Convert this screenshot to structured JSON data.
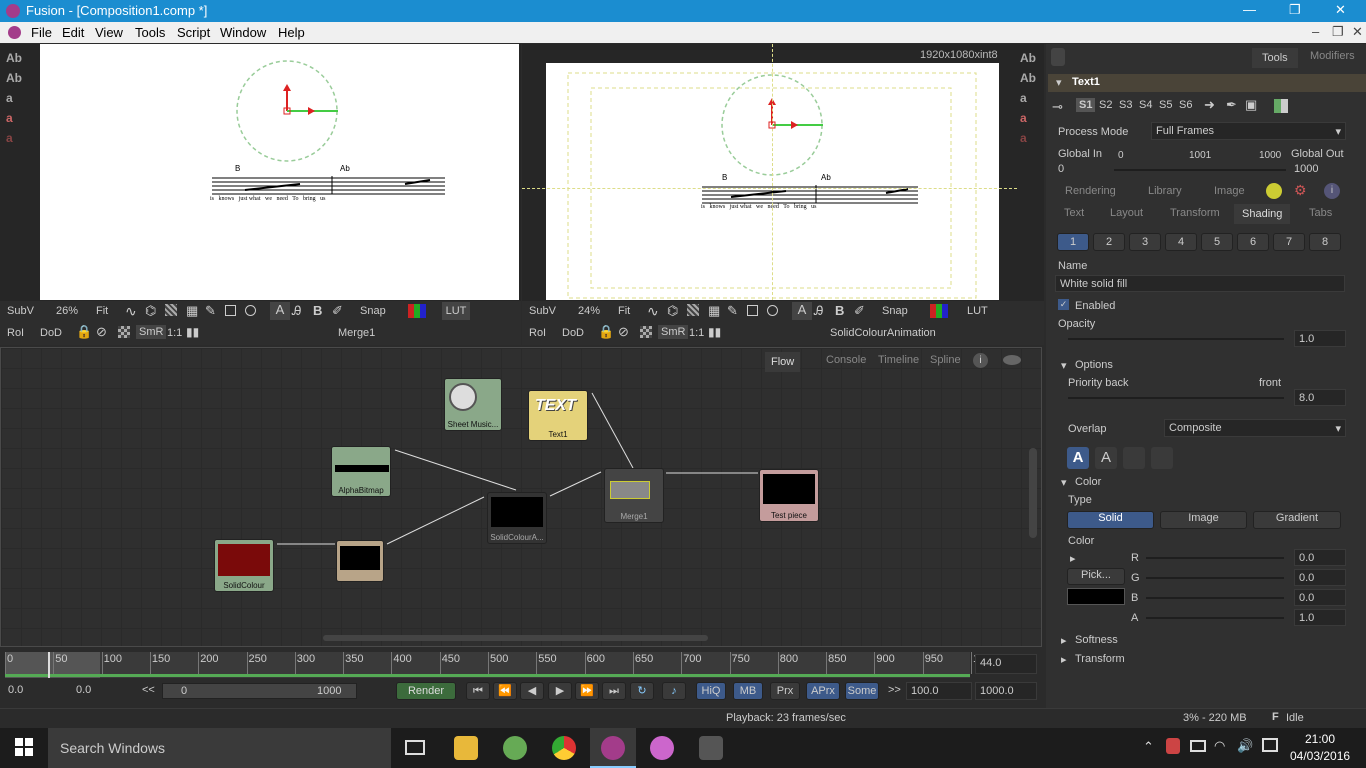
{
  "window": {
    "title": "Fusion - [Composition1.comp *]",
    "minimize": "—",
    "maximize": "❐",
    "close": "✕"
  },
  "menu": [
    "File",
    "Edit",
    "View",
    "Tools",
    "Script",
    "Window",
    "Help"
  ],
  "viewer_left": {
    "subv": "SubV",
    "zoom": "26%",
    "fit": "Fit",
    "snap": "Snap",
    "lut": "LUT",
    "roi": "RoI",
    "dod": "DoD",
    "smr": "SmR",
    "ratio": "1:1",
    "name": "Merge1",
    "side_buttons": [
      "Ab",
      "Ab",
      "a",
      "a",
      "a"
    ]
  },
  "viewer_right": {
    "subv": "SubV",
    "zoom": "24%",
    "fit": "Fit",
    "snap": "Snap",
    "lut": "LUT",
    "roi": "RoI",
    "dod": "DoD",
    "smr": "SmR",
    "ratio": "1:1",
    "name": "SolidColourAnimation",
    "resolution": "1920x1080xint8",
    "side_buttons": [
      "Ab",
      "Ab",
      "a",
      "a",
      "a"
    ]
  },
  "score_text": {
    "lyrics_left": "is   knows   just what   we   need   To   bring   us",
    "lyrics_right": "is   knows   just what   we   need   To   bring   us"
  },
  "flow_tabs": [
    "Flow",
    "Console",
    "Timeline",
    "Spline"
  ],
  "nodes": {
    "sheet": "Sheet Music...",
    "text1": "Text1",
    "alpha": "AlphaBitmap",
    "solidanim": "SolidColourA...",
    "merge": "Merge1",
    "testpiece": "Test piece",
    "solidcolour": "SolidColour"
  },
  "panel": {
    "tabs": [
      "Tools",
      "Modifiers"
    ],
    "tool_name": "Text1",
    "slots": [
      "S1",
      "S2",
      "S3",
      "S4",
      "S5",
      "S6"
    ],
    "process_mode_label": "Process Mode",
    "process_mode": "Full Frames",
    "global_in_label": "Global In",
    "global_in": "0",
    "global_out_label": "Global Out",
    "global_out": "1000",
    "range_start": "0",
    "range_mid": "1001",
    "range_end": "1000",
    "tabs_row1": [
      "Rendering",
      "Library",
      "Image"
    ],
    "tabs_row2": [
      "Text",
      "Layout",
      "Transform",
      "Shading",
      "Tabs"
    ],
    "shading_nums": [
      "1",
      "2",
      "3",
      "4",
      "5",
      "6",
      "7",
      "8"
    ],
    "name_label": "Name",
    "name_value": "White solid fill",
    "enabled_label": "Enabled",
    "opacity_label": "Opacity",
    "opacity": "1.0",
    "options_label": "Options",
    "priority_label": "Priority back",
    "priority_front": "front",
    "priority": "8.0",
    "overlap_label": "Overlap",
    "overlap": "Composite",
    "color_section": "Color",
    "type_label": "Type",
    "type_buttons": [
      "Solid",
      "Image",
      "Gradient"
    ],
    "color_label": "Color",
    "pick_label": "Pick...",
    "channels": [
      {
        "c": "R",
        "v": "0.0"
      },
      {
        "c": "G",
        "v": "0.0"
      },
      {
        "c": "B",
        "v": "0.0"
      },
      {
        "c": "A",
        "v": "1.0"
      }
    ],
    "softness": "Softness",
    "transform": "Transform"
  },
  "timeline": {
    "ticks": [
      "0",
      "50",
      "100",
      "150",
      "200",
      "250",
      "300",
      "350",
      "400",
      "450",
      "500",
      "550",
      "600",
      "650",
      "700",
      "750",
      "800",
      "850",
      "900",
      "950",
      "1"
    ],
    "current": "44.0",
    "start": "0.0",
    "render_start": "0.0",
    "range_a": "0",
    "range_b": "1000",
    "render": "Render",
    "hiq": "HiQ",
    "mb": "MB",
    "prx": "Prx",
    "aprx": "APrx",
    "some": "Some",
    "ll": "<<",
    "gg": ">>",
    "end1": "100.0",
    "end2": "1000.0"
  },
  "status": {
    "playback": "Playback: 23 frames/sec",
    "mem": "3% - 220 MB",
    "state": "Idle"
  },
  "taskbar": {
    "search": "Search Windows",
    "time": "21:00",
    "date": "04/03/2016"
  },
  "colors": {
    "accent": "#1b8dd0",
    "node_green": "#8aa889",
    "node_yellow": "#e4d27a",
    "node_pink": "#c49c9c",
    "node_tan": "#b8a488"
  }
}
